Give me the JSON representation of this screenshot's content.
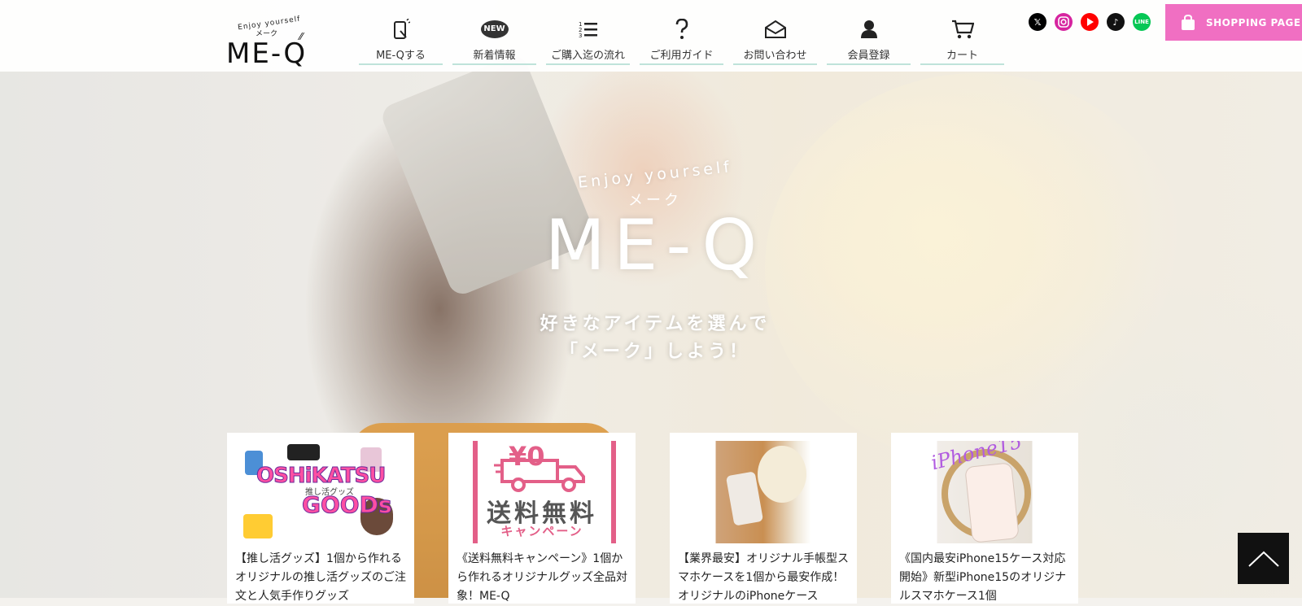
{
  "logo": {
    "enjoy": "Enjoy yourself",
    "kana": "メーク",
    "word": "ME-Q"
  },
  "nav": [
    {
      "label": "ME-Qする",
      "icon": "phone-q-icon"
    },
    {
      "label": "新着情報",
      "icon": "new-badge-icon",
      "badge": "NEW"
    },
    {
      "label": "ご購入迄の流れ",
      "icon": "numbered-list-icon"
    },
    {
      "label": "ご利用ガイド",
      "icon": "question-mark-icon"
    },
    {
      "label": "お問い合わせ",
      "icon": "envelope-icon"
    },
    {
      "label": "会員登録",
      "icon": "user-icon"
    },
    {
      "label": "カート",
      "icon": "cart-icon"
    }
  ],
  "social": [
    {
      "name": "x-icon",
      "color": "#000000"
    },
    {
      "name": "instagram-icon",
      "color": "#d6249f"
    },
    {
      "name": "youtube-icon",
      "color": "#ff0000"
    },
    {
      "name": "tiktok-icon",
      "color": "#111111"
    },
    {
      "name": "line-icon",
      "color": "#06c755"
    }
  ],
  "shop_button": {
    "label": "SHOPPING PAGE",
    "color": "#f06fc2"
  },
  "hero": {
    "enjoy": "Enjoy yourself",
    "kana": "メーク",
    "word": "ME-Q",
    "tagline1": "好きなアイテムを選んで",
    "tagline2": "「メーク」しよう！"
  },
  "cards": [
    {
      "thumb": {
        "line1": "OSHiKATSU",
        "line2": "GOODs",
        "small": "推し活グッズ"
      },
      "text": "【推し活グッズ】1個から作れるオリジナルの推し活グッズのご注文と人気手作りグッズ"
    },
    {
      "thumb": {
        "yen": "¥0",
        "free": "送料無料",
        "campaign": "キャンペーン"
      },
      "text": "《送料無料キャンペーン》1個から作れるオリジナルグッズ全品対象！ME-Q"
    },
    {
      "thumb": {},
      "text": "【業界最安】オリジナル手帳型スマホケースを1個から最安作成！オリジナルのiPhoneケース"
    },
    {
      "thumb": {
        "script": "iPhone15"
      },
      "text": "《国内最安iPhone15ケース対応開始》新型iPhone15のオリジナルスマホケース1個"
    }
  ],
  "accent_colors": {
    "nav_underline": "#bfe3da",
    "pink": "#f06fc2",
    "campaign_pink": "#e35f88"
  }
}
